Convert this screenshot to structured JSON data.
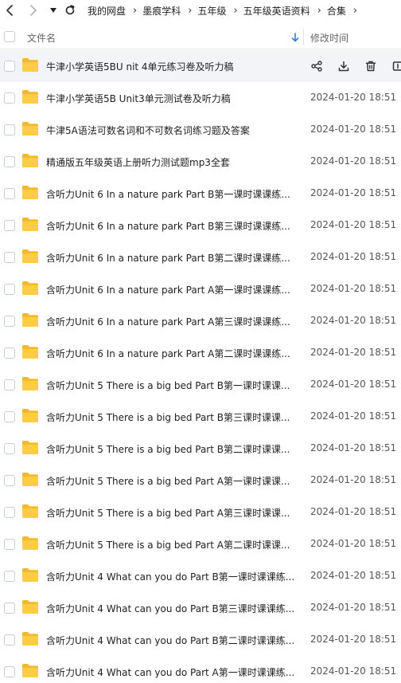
{
  "breadcrumb": [
    "我的网盘",
    "墨痕学科",
    "五年级",
    "五年级英语资料",
    "合集"
  ],
  "header": {
    "name": "文件名",
    "time": "修改时间"
  },
  "files": [
    {
      "name": "牛津小学英语5BU nit 4单元练习卷及听力稿",
      "time": ""
    },
    {
      "name": "牛津小学英语5B Unit3单元测试卷及听力稿",
      "time": "2024-01-20 18:51"
    },
    {
      "name": "牛津5A语法可数名词和不可数名词练习题及答案",
      "time": "2024-01-20 18:51"
    },
    {
      "name": "精通版五年级英语上册听力测试题mp3全套",
      "time": "2024-01-20 18:51"
    },
    {
      "name": "含听力Unit 6 In a nature park Part B第一课时课课练...",
      "time": "2024-01-20 18:51"
    },
    {
      "name": "含听力Unit 6 In a nature park Part B第三课时课课练...",
      "time": "2024-01-20 18:51"
    },
    {
      "name": "含听力Unit 6 In a nature park Part B第二课时课课练...",
      "time": "2024-01-20 18:51"
    },
    {
      "name": "含听力Unit 6 In a nature park Part A第一课时课课练...",
      "time": "2024-01-20 18:51"
    },
    {
      "name": "含听力Unit 6 In a nature park Part A第三课时课课练...",
      "time": "2024-01-20 18:51"
    },
    {
      "name": "含听力Unit 6 In a nature park Part A第二课时课课练...",
      "time": "2024-01-20 18:51"
    },
    {
      "name": "含听力Unit 5 There is a big bed Part B第一课时课课...",
      "time": "2024-01-20 18:51"
    },
    {
      "name": "含听力Unit 5 There is a big bed Part B第三课时课课...",
      "time": "2024-01-20 18:51"
    },
    {
      "name": "含听力Unit 5 There is a big bed Part B第二课时课课...",
      "time": "2024-01-20 18:51"
    },
    {
      "name": "含听力Unit 5 There is a big bed Part A第一课时课课...",
      "time": "2024-01-20 18:51"
    },
    {
      "name": "含听力Unit 5 There is a big bed Part A第三课时课课...",
      "time": "2024-01-20 18:51"
    },
    {
      "name": "含听力Unit 5 There is a big bed Part A第二课时课课...",
      "time": "2024-01-20 18:51"
    },
    {
      "name": "含听力Unit 4 What can you do Part B第一课时课课练...",
      "time": "2024-01-20 18:51"
    },
    {
      "name": "含听力Unit 4 What can you do Part B第三课时课课练...",
      "time": "2024-01-20 18:51"
    },
    {
      "name": "含听力Unit 4 What can you do Part B第二课时课课练...",
      "time": "2024-01-20 18:51"
    },
    {
      "name": "含听力Unit 4 What can you do Part A第一课时课课练...",
      "time": "2024-01-20 18:51"
    }
  ],
  "icons": {
    "back": "chevron-left-icon",
    "forward": "chevron-right-icon",
    "history": "caret-down-icon",
    "refresh": "refresh-icon",
    "folder": "folder-icon",
    "sort": "sort-down-icon",
    "row_actions": [
      "share-icon",
      "download-icon",
      "delete-icon",
      "more-icon"
    ]
  },
  "colors": {
    "folder": "#F7C23F",
    "accent": "#2F7BF6",
    "hover_row": "#F2F4F8"
  }
}
